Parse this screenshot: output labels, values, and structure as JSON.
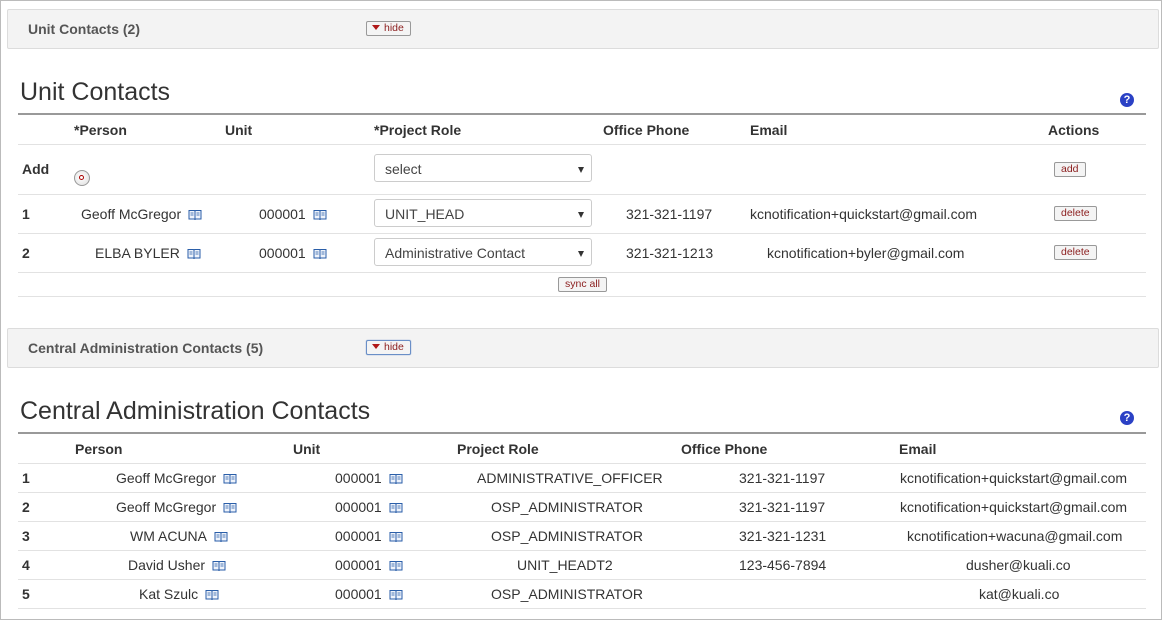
{
  "unit_panel": {
    "title": "Unit Contacts (2)",
    "hide_label": "hide"
  },
  "unit_section": {
    "heading": "Unit Contacts",
    "help": "?",
    "headers": {
      "person": "*Person",
      "unit": "Unit",
      "role": "*Project Role",
      "phone": "Office Phone",
      "email": "Email",
      "actions": "Actions"
    },
    "add_row": {
      "label": "Add",
      "role_select": "select",
      "add_button": "add"
    },
    "rows": [
      {
        "num": "1",
        "person": "Geoff McGregor",
        "unit": "000001",
        "role": "UNIT_HEAD",
        "phone": "321-321-1197",
        "email": "kcnotification+quickstart@gmail.com",
        "action": "delete"
      },
      {
        "num": "2",
        "person": "ELBA BYLER",
        "unit": "000001",
        "role": "Administrative Contact",
        "phone": "321-321-1213",
        "email": "kcnotification+byler@gmail.com",
        "action": "delete"
      }
    ],
    "sync_label": "sync all"
  },
  "central_panel": {
    "title": "Central Administration Contacts (5)",
    "hide_label": "hide"
  },
  "central_section": {
    "heading": "Central Administration Contacts",
    "help": "?",
    "headers": {
      "person": "Person",
      "unit": "Unit",
      "role": "Project Role",
      "phone": "Office Phone",
      "email": "Email"
    },
    "rows": [
      {
        "num": "1",
        "person": "Geoff McGregor",
        "unit": "000001",
        "role": "ADMINISTRATIVE_OFFICER",
        "phone": "321-321-1197",
        "email": "kcnotification+quickstart@gmail.com"
      },
      {
        "num": "2",
        "person": "Geoff McGregor",
        "unit": "000001",
        "role": "OSP_ADMINISTRATOR",
        "phone": "321-321-1197",
        "email": "kcnotification+quickstart@gmail.com"
      },
      {
        "num": "3",
        "person": "WM ACUNA",
        "unit": "000001",
        "role": "OSP_ADMINISTRATOR",
        "phone": "321-321-1231",
        "email": "kcnotification+wacuna@gmail.com"
      },
      {
        "num": "4",
        "person": "David Usher",
        "unit": "000001",
        "role": "UNIT_HEADT2",
        "phone": "123-456-7894",
        "email": "dusher@kuali.co"
      },
      {
        "num": "5",
        "person": "Kat Szulc",
        "unit": "000001",
        "role": "OSP_ADMINISTRATOR",
        "phone": "",
        "email": "kat@kuali.co"
      }
    ]
  }
}
